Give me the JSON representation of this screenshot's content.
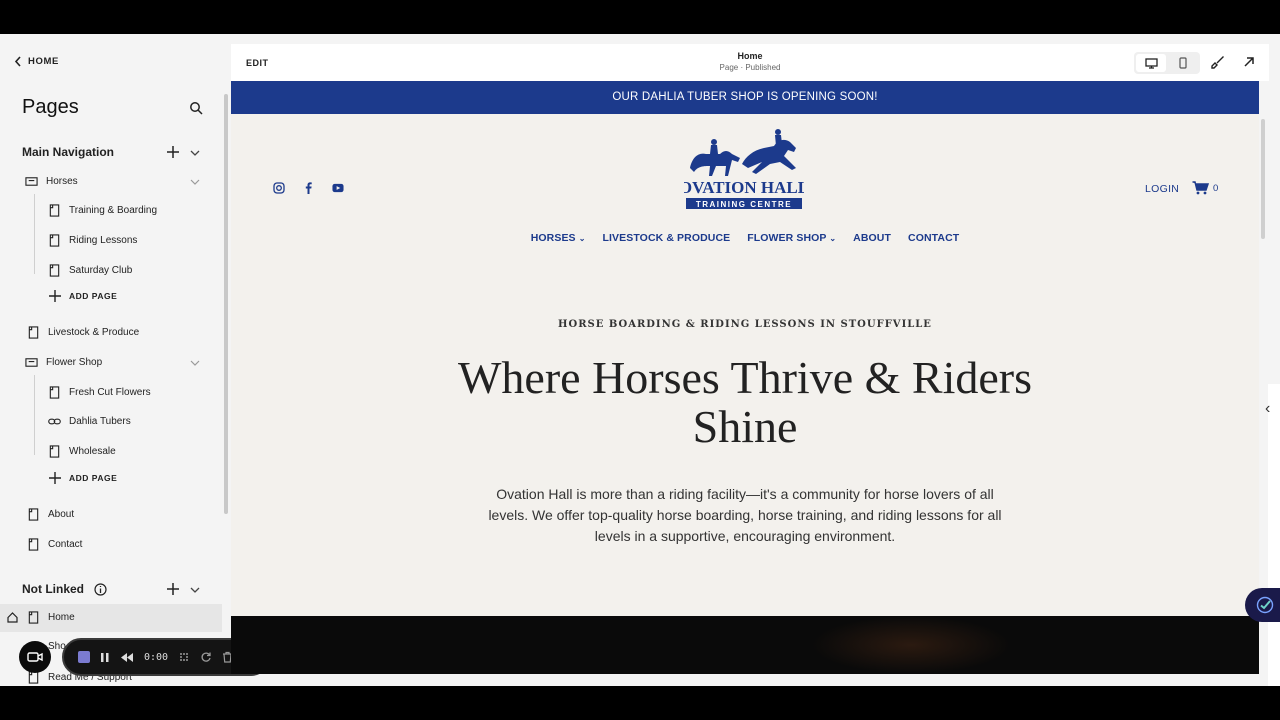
{
  "sidebar": {
    "back_label": "HOME",
    "title": "Pages",
    "main_nav_label": "Main Navigation",
    "not_linked_label": "Not Linked",
    "add_page_label": "ADD PAGE",
    "items": {
      "horses": "Horses",
      "training": "Training & Boarding",
      "riding": "Riding Lessons",
      "saturday": "Saturday Club",
      "livestock": "Livestock & Produce",
      "flower": "Flower Shop",
      "fresh": "Fresh Cut Flowers",
      "dahlia": "Dahlia Tubers",
      "wholesale": "Wholesale",
      "about": "About",
      "contact": "Contact",
      "home": "Home",
      "shop": "Sho",
      "readme": "Read Me / Support"
    }
  },
  "recorder": {
    "time": "0:00"
  },
  "topbar": {
    "edit_label": "EDIT",
    "page_title": "Home",
    "page_status": "Page · Published"
  },
  "site": {
    "announcement": "OUR DAHLIA TUBER SHOP IS OPENING SOON!",
    "logo_text": "OVATION HALL",
    "logo_sub": "TRAINING CENTRE",
    "login_label": "LOGIN",
    "cart_count": "0",
    "menu": [
      "HORSES",
      "LIVESTOCK & PRODUCE",
      "FLOWER SHOP",
      "ABOUT",
      "CONTACT"
    ],
    "eyebrow": "HORSE BOARDING & RIDING LESSONS IN STOUFFVILLE",
    "headline": "Where Horses Thrive & Riders Shine",
    "body": "Ovation Hall is more than a riding facility—it's a community for horse lovers of all levels. We offer top-quality horse boarding, horse training, and riding lessons for all levels in a supportive, encouraging environment."
  },
  "colors": {
    "brand_blue": "#1c3a8c",
    "cream": "#f3f1ed"
  }
}
